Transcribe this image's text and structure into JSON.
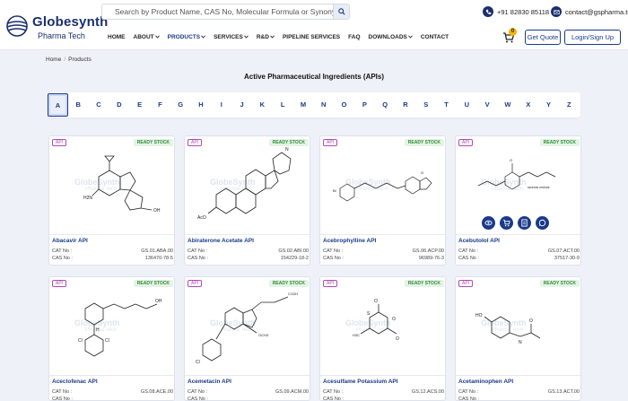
{
  "brand": {
    "name": "Globesynth",
    "tagline": "Pharma Tech"
  },
  "search": {
    "placeholder": "Search by Product Name, CAS No, Molecular Formula or Synonyms..."
  },
  "contact": {
    "phone": "+91 82830 85118",
    "email": "contact@gspharma.tech"
  },
  "nav": [
    "HOME",
    "ABOUT",
    "PRODUCTS",
    "SERVICES",
    "R&D",
    "PIPELINE SERVICES",
    "FAQ",
    "DOWNLOADS",
    "CONTACT"
  ],
  "nav_dropdowns": [
    false,
    true,
    true,
    true,
    true,
    false,
    false,
    true,
    false
  ],
  "nav_active": "PRODUCTS",
  "cart_count": "0",
  "buttons": {
    "quote": "Get Quote",
    "login": "Login/Sign Up"
  },
  "breadcrumb": {
    "home": "Home",
    "separator": "/",
    "current": "Products"
  },
  "page_title": "Active Pharmaceutical Ingredients (APIs)",
  "alphabet": [
    "A",
    "B",
    "C",
    "D",
    "E",
    "F",
    "G",
    "H",
    "I",
    "J",
    "K",
    "L",
    "M",
    "N",
    "O",
    "P",
    "Q",
    "R",
    "S",
    "T",
    "U",
    "V",
    "W",
    "X",
    "Y",
    "Z"
  ],
  "alphabet_selected": "A",
  "watermark": {
    "line1": "GlobeSynth",
    "line2": "Pharma Tech"
  },
  "labels": {
    "api_tag": "API",
    "stock_tag": "READY STOCK",
    "cat": "CAT No :",
    "cas": "CAS No :"
  },
  "colors": {
    "primary": "#1a3a8a",
    "stock": "#2e8b3a",
    "api_tag": "#b04ab8",
    "badge": "#f5b400"
  },
  "products": [
    {
      "name": "Abacavir API",
      "cat": "GS.01.ABA.00",
      "cas": "136470-78-5"
    },
    {
      "name": "Abiraterone Acetate API",
      "cat": "GS.02.ABI.00",
      "cas": "154229-18-2"
    },
    {
      "name": "Acebrophylline API",
      "cat": "GS.06.ACP.00",
      "cas": "96989-76-3"
    },
    {
      "name": "Acebutolol API",
      "cat": "GS.07.ACT.00",
      "cas": "37517-30-9"
    },
    {
      "name": "Aceclofenac API",
      "cat": "GS.08.ACE.00",
      "cas": ""
    },
    {
      "name": "Acemetacin API",
      "cat": "GS.09.ACM.00",
      "cas": ""
    },
    {
      "name": "Acesulfame Potassium API",
      "cat": "GS.12.ACS.00",
      "cas": ""
    },
    {
      "name": "Acetaminophen API",
      "cat": "GS.13.ACT.00",
      "cas": ""
    }
  ],
  "hover_actions": [
    "view-icon",
    "cart-icon",
    "document-icon",
    "whatsapp-icon"
  ]
}
